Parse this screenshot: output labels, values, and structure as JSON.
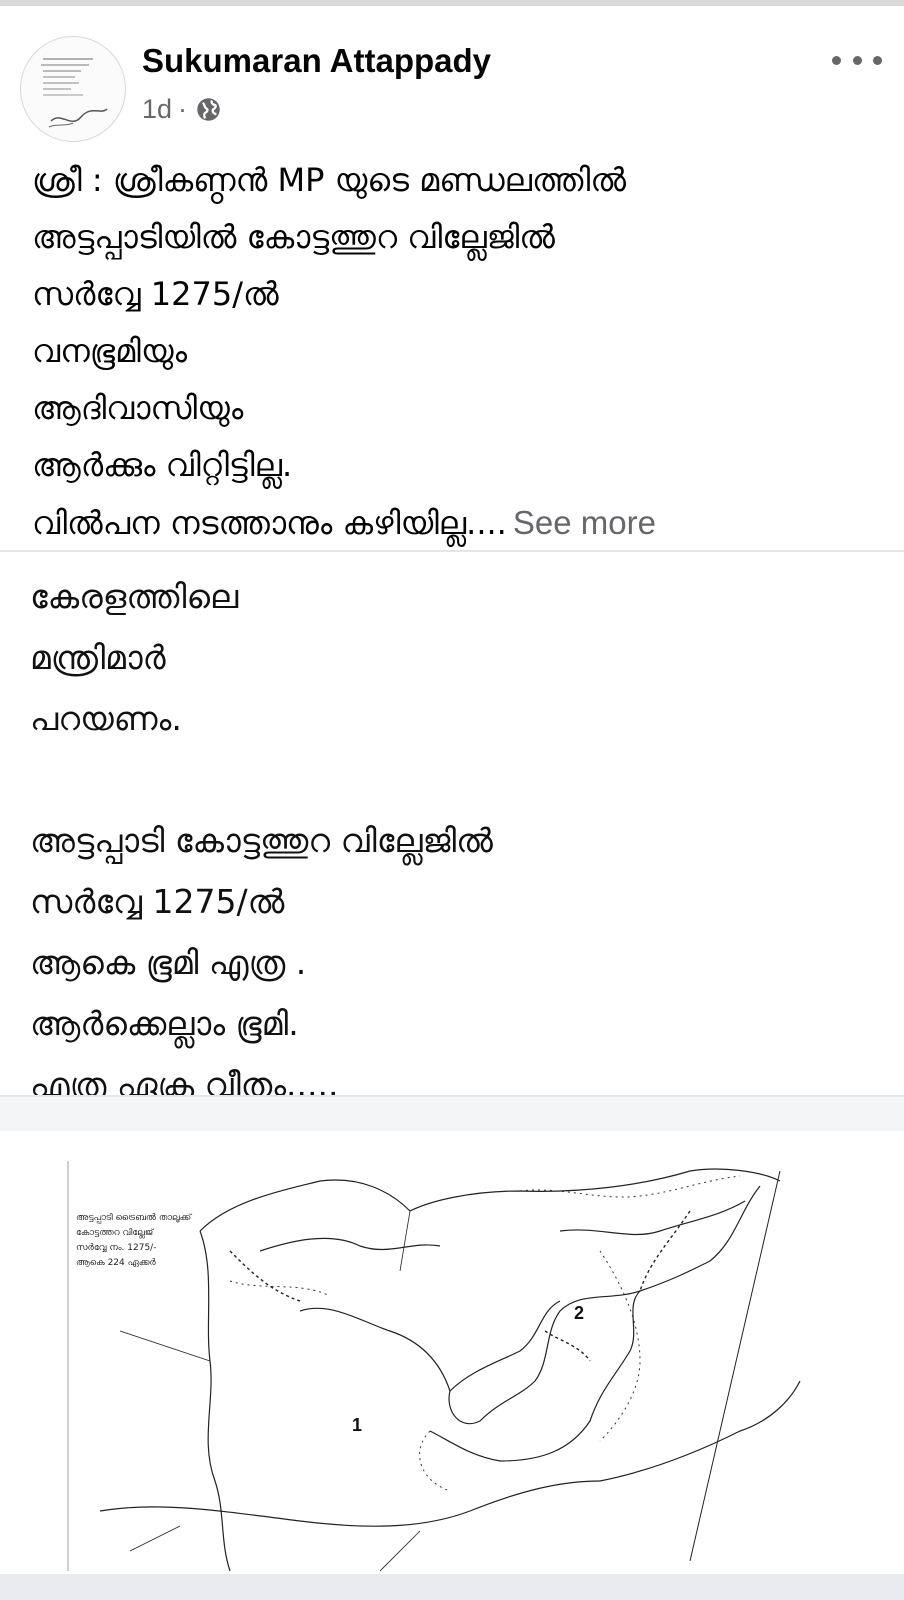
{
  "post": {
    "author": "Sukumaran Attappady",
    "time": "1d",
    "separator": "·",
    "privacy_icon": "globe-icon",
    "more_icon": "more-options-icon",
    "caption_lines": [
      "ശ്രീ : ശ്രീകണ്ഠൻ MP യുടെ മണ്ഡലത്തിൽ",
      "അട്ടപ്പാടിയിൽ കോട്ടത്തുറ വില്ലേജിൽ",
      "സർവ്വേ 1275/ൽ",
      "വനഭൂമിയും",
      "ആദിവാസിയും",
      "ആർക്കും വിറ്റിട്ടില്ല.",
      "വിൽപന നടത്താനും കഴിയില്ല...."
    ],
    "see_more": "See more"
  },
  "image_text": {
    "lines": [
      "കേരളത്തിലെ",
      "മന്ത്രിമാർ",
      "പറയണം.",
      "",
      "അട്ടപ്പാടി കോട്ടത്തുറ വില്ലേജിൽ",
      "സർവ്വേ 1275/ൽ",
      "ആകെ ഭൂമി എത്ര .",
      "ആർക്കെല്ലാം ഭൂമി.",
      " എത്ര ഏക്ര വീതം....."
    ]
  },
  "map": {
    "legend_lines": [
      "അട്ടപ്പാടി ട്രൈബൽ താലൂക്ക്",
      "കോട്ടത്തറ വില്ലേജ്",
      "സർവ്വേ നം. 1275/-",
      "ആകെ 224 ഏക്കർ"
    ],
    "parcel_1": "1",
    "parcel_2": "2"
  }
}
